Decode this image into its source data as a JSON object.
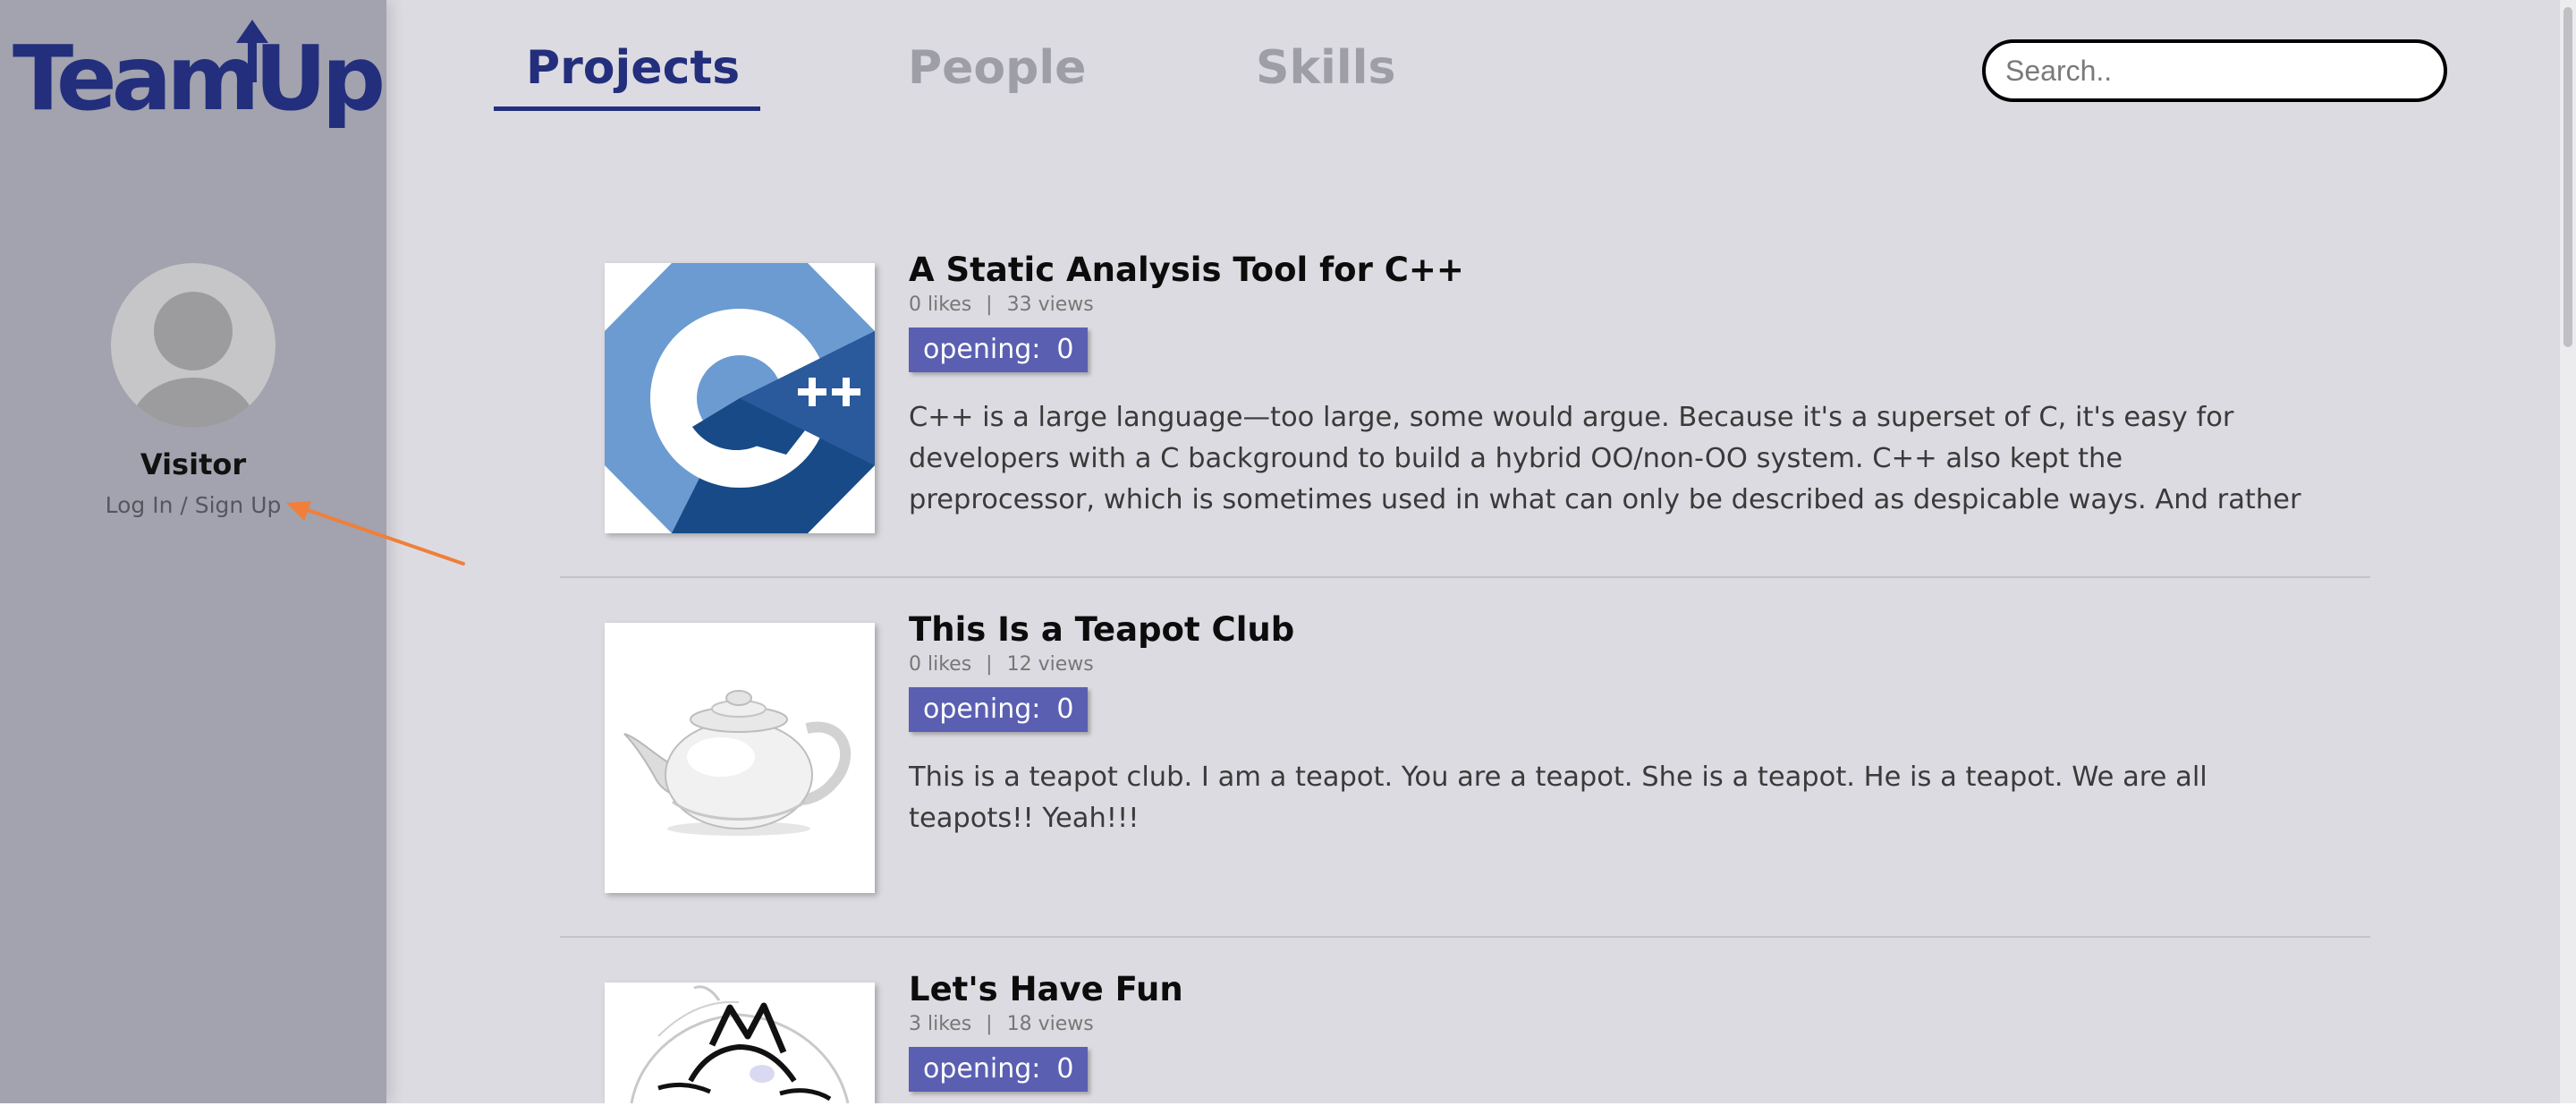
{
  "app": {
    "logo_text": "TeamUp",
    "brand_color": "#232f7c",
    "accent_color": "#5a5fb2"
  },
  "sidebar": {
    "user_name": "Visitor",
    "login_link": "Log In / Sign Up",
    "avatar_icon": "user-avatar-icon"
  },
  "nav": {
    "tabs": [
      {
        "label": "Projects",
        "active": true
      },
      {
        "label": "People",
        "active": false
      },
      {
        "label": "Skills",
        "active": false
      }
    ],
    "search_placeholder": "Search.."
  },
  "projects": [
    {
      "title": "A Static Analysis Tool for C++",
      "likes": "0 likes",
      "views": "33 views",
      "opening_label": "opening:",
      "opening_count": "0",
      "image": "cpp-logo-icon",
      "description": "C++ is a large language—too large, some would argue. Because it's a superset of C, it's easy for developers with a C background to build a hybrid OO/non-OO system. C++ also kept the preprocessor, which is sometimes used in what can only be described as despicable ways. And rather than risk offending legacy"
    },
    {
      "title": "This Is a Teapot Club",
      "likes": "0 likes",
      "views": "12 views",
      "opening_label": "opening:",
      "opening_count": "0",
      "image": "teapot-image",
      "description": "This is a teapot club. I am a teapot. You are a teapot. She is a teapot. He is a teapot. We are all teapots!! Yeah!!!"
    },
    {
      "title": "Let's Have Fun",
      "likes": "3 likes",
      "views": "18 views",
      "opening_label": "opening:",
      "opening_count": "0",
      "image": "cat-sketch-image",
      "description": ""
    }
  ],
  "separator": "|"
}
